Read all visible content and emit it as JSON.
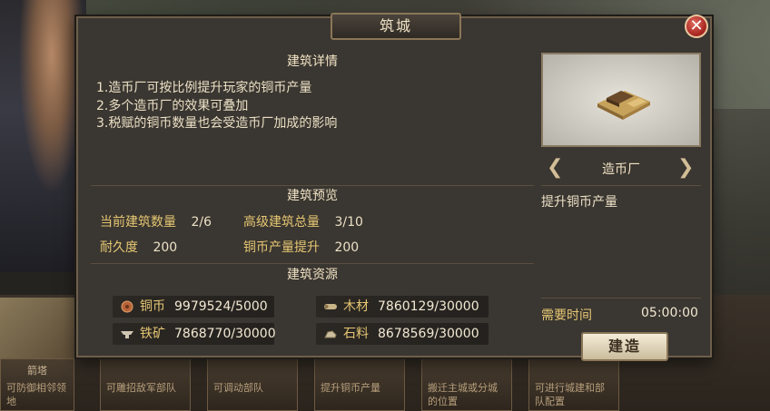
{
  "dialog": {
    "title": "筑城",
    "close_glyph": "✕"
  },
  "details": {
    "header": "建筑详情",
    "lines": [
      "1.造币厂可按比例提升玩家的铜币产量",
      "2.多个造币厂的效果可叠加",
      "3.税赋的铜币数量也会受造币厂加成的影响"
    ]
  },
  "preview": {
    "header": "建筑预览",
    "current_count_label": "当前建筑数量",
    "current_count_value": "2/6",
    "advanced_total_label": "高级建筑总量",
    "advanced_total_value": "3/10",
    "durability_label": "耐久度",
    "durability_value": "200",
    "copper_boost_label": "铜币产量提升",
    "copper_boost_value": "200"
  },
  "resources": {
    "header": "建筑资源",
    "items": [
      {
        "label": "铜币",
        "value": "9979524/5000",
        "icon": "coin-icon"
      },
      {
        "label": "木材",
        "value": "7860129/30000",
        "icon": "wood-icon"
      },
      {
        "label": "铁矿",
        "value": "7868770/30000",
        "icon": "iron-icon"
      },
      {
        "label": "石料",
        "value": "8678569/30000",
        "icon": "stone-icon"
      }
    ]
  },
  "building": {
    "name": "造币厂",
    "effect": "提升铜币产量",
    "time_label": "需要时间",
    "time_value": "05:00:00",
    "build_label": "建造"
  },
  "background": {
    "slots": [
      {
        "title": "箭塔",
        "desc": "可防御相邻领地"
      },
      {
        "title": "",
        "desc": "可雕招敌军部队"
      },
      {
        "title": "",
        "desc": "可调动部队"
      },
      {
        "title": "",
        "desc": "提升铜币产量"
      },
      {
        "title": "",
        "desc": "搬迁主城或分城的位置"
      },
      {
        "title": "",
        "desc": "可进行城建和部队配置"
      }
    ]
  },
  "colors": {
    "accent_gold": "#e6c773",
    "close_red": "#a3231d",
    "panel": "#3a3631"
  }
}
